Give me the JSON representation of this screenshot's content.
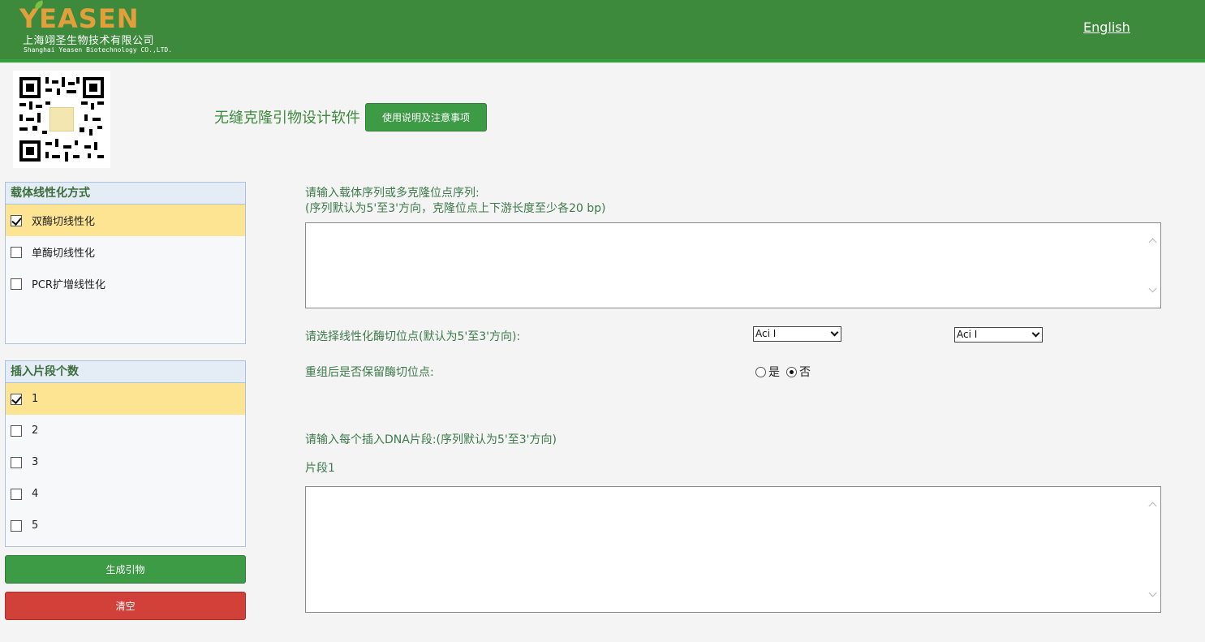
{
  "header": {
    "logo_text": "YEASEN",
    "company_cn": "上海翊圣生物技术有限公司",
    "company_en": "Shanghai Yeasen Biotechnology CO.,LTD.",
    "language_link": "English",
    "bg_color": "#3d8a3d"
  },
  "title": {
    "text": "无缝克隆引物设计软件",
    "help_button": "使用说明及注意事项"
  },
  "linearization_panel": {
    "heading": "载体线性化方式",
    "options": [
      {
        "label": "双酶切线性化",
        "checked": true
      },
      {
        "label": "单酶切线性化",
        "checked": false
      },
      {
        "label": "PCR扩增线性化",
        "checked": false
      }
    ]
  },
  "insert_panel": {
    "heading": "插入片段个数",
    "options": [
      {
        "label": "1",
        "checked": true
      },
      {
        "label": "2",
        "checked": false
      },
      {
        "label": "3",
        "checked": false
      },
      {
        "label": "4",
        "checked": false
      },
      {
        "label": "5",
        "checked": false
      }
    ]
  },
  "actions": {
    "generate": "生成引物",
    "clear": "清空"
  },
  "vector": {
    "label_line1": "请输入载体序列或多克隆位点序列:",
    "label_line2": "(序列默认为5'至3'方向，克隆位点上下游长度至少各20 bp)",
    "value": ""
  },
  "enzyme": {
    "label": "请选择线性化酶切位点(默认为5'至3'方向):",
    "site1": "Aci I",
    "site2": "Aci I"
  },
  "retain": {
    "label": "重组后是否保留酶切位点:",
    "yes": "是",
    "no": "否",
    "selected": "否"
  },
  "fragments": {
    "label": "请输入每个插入DNA片段:(序列默认为5'至3'方向)",
    "fragment1_label": "片段1",
    "fragment1_value": ""
  }
}
